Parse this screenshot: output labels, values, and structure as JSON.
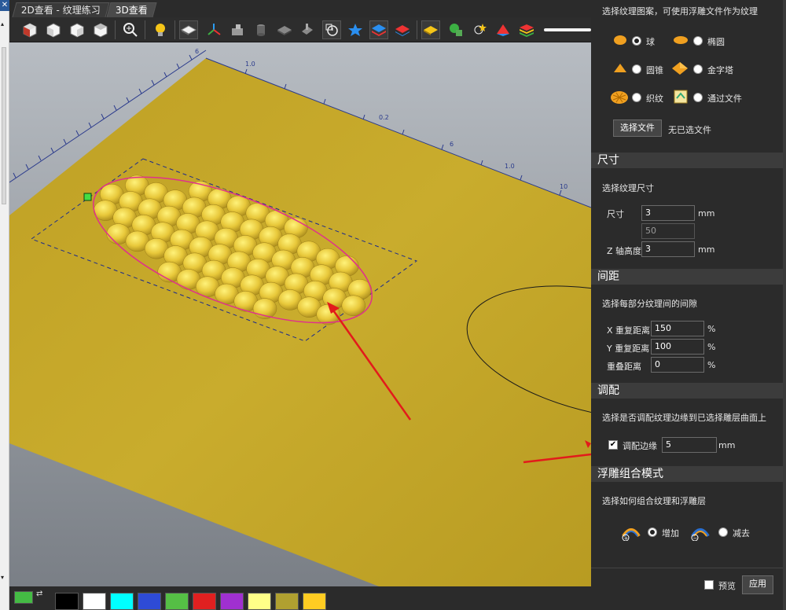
{
  "tabs": [
    {
      "label": "2D查看 - 纹理练习",
      "active": false
    },
    {
      "label": "3D查看",
      "active": true
    }
  ],
  "toolbar": {
    "icons": [
      "view-iso-icon",
      "view-front-icon",
      "view-side-icon",
      "view-top-icon",
      "zoom-fit-icon",
      "light-icon",
      "surface-icon",
      "axis-icon",
      "render-icon",
      "cylinder-icon",
      "plate-icon",
      "tool-icon",
      "trace-icon",
      "star-icon",
      "layers-icon",
      "layer-red-icon",
      "material-icon",
      "shape-green-icon",
      "magic-icon",
      "relief-icon",
      "stack-icon"
    ]
  },
  "viewport": {
    "ruler_labels": [
      "6",
      "1.0",
      "0.2",
      "6",
      "1.0",
      "10"
    ],
    "colors": {
      "plate": "#c4a92a",
      "background_top": "#a8aeb6",
      "background_bottom": "#7b8087",
      "selection": "#e0308c",
      "bounding": "#1b2a8c",
      "arrow": "#e21b1b"
    }
  },
  "palette": {
    "swatches": [
      "#000000",
      "#ffffff",
      "#00ffff",
      "#2e4bd6",
      "#55bf45",
      "#e02020",
      "#a030d0",
      "#ffff88",
      "#b0a030",
      "#ffcc22"
    ],
    "current": "#44bb44"
  },
  "panel": {
    "texture": {
      "hint": "选择纹理图案，可使用浮雕文件作为纹理",
      "options": [
        {
          "label": "球",
          "selected": true
        },
        {
          "label": "椭圆",
          "selected": false
        },
        {
          "label": "圆锥",
          "selected": false
        },
        {
          "label": "金字塔",
          "selected": false
        },
        {
          "label": "织纹",
          "selected": false
        },
        {
          "label": "通过文件",
          "selected": false
        }
      ],
      "choose_file_label": "选择文件",
      "file_status": "无已选文件"
    },
    "size": {
      "title": "尺寸",
      "hint": "选择纹理尺寸",
      "size_label": "尺寸",
      "size_value": "3",
      "size_percent": "50",
      "z_label": "Z 轴高度",
      "z_value": "3",
      "unit": "mm"
    },
    "spacing": {
      "title": "间距",
      "hint": "选择每部分纹理间的间隙",
      "x_label": "X 重复距离",
      "x_value": "150",
      "y_label": "Y 重复距离",
      "y_value": "100",
      "overlap_label": "重叠距离",
      "overlap_value": "0",
      "unit": "%"
    },
    "fit": {
      "title": "调配",
      "hint": "选择是否调配纹理边缘到已选择雕层曲面上",
      "check_label": "调配边缘",
      "checked": true,
      "value": "5",
      "unit": "mm"
    },
    "combine": {
      "title": "浮雕组合模式",
      "hint": "选择如何组合纹理和浮雕层",
      "add_label": "增加",
      "add_selected": true,
      "subtract_label": "减去",
      "subtract_selected": false
    },
    "footer": {
      "preview_label": "预览",
      "apply_label": "应用"
    }
  }
}
